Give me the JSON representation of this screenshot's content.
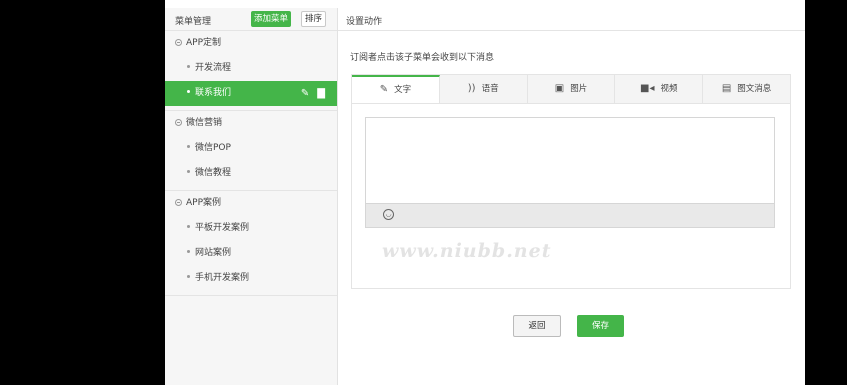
{
  "menu_panel": {
    "title": "菜单管理",
    "add_label": "添加菜单",
    "sort_label": "排序",
    "groups": [
      {
        "label": "APP定制",
        "children": [
          {
            "label": "开发流程"
          },
          {
            "label": "联系我们",
            "active": true
          }
        ]
      },
      {
        "label": "微信营销",
        "children": [
          {
            "label": "微信POP"
          },
          {
            "label": "微信教程"
          }
        ]
      },
      {
        "label": "APP案例",
        "children": [
          {
            "label": "平板开发案例"
          },
          {
            "label": "网站案例"
          },
          {
            "label": "手机开发案例"
          }
        ]
      }
    ],
    "active_icons": [
      "pencil-icon",
      "trash-icon"
    ]
  },
  "action_panel": {
    "title": "设置动作",
    "hint": "订阅者点击该子菜单会收到以下消息",
    "tabs": [
      {
        "label": "文字",
        "icon": "pencil-icon",
        "active": true
      },
      {
        "label": "语音",
        "icon": "audio-icon"
      },
      {
        "label": "图片",
        "icon": "image-icon"
      },
      {
        "label": "视频",
        "icon": "video-icon"
      },
      {
        "label": "图文消息",
        "icon": "news-icon"
      }
    ],
    "textarea_value": "",
    "emoji_icon": "emoji-icon"
  },
  "watermark": "www.niubb.net",
  "buttons": {
    "back": "返回",
    "save": "保存"
  },
  "colors": {
    "accent": "#44b549",
    "background": "#000000",
    "panel": "#f6f6f6"
  }
}
